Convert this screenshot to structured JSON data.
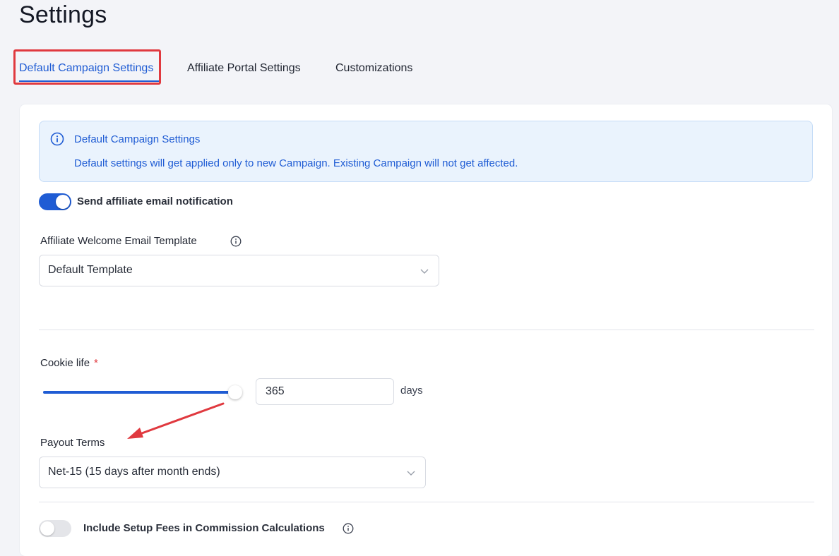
{
  "page": {
    "title": "Settings"
  },
  "tabs": [
    {
      "label": "Default Campaign Settings",
      "active": true
    },
    {
      "label": "Affiliate Portal Settings",
      "active": false
    },
    {
      "label": "Customizations",
      "active": false
    }
  ],
  "info": {
    "title": "Default Campaign Settings",
    "text": "Default settings will get applied only to new Campaign. Existing Campaign will not get affected.",
    "icon": "info-circle-icon"
  },
  "email_notification": {
    "label": "Send affiliate email notification",
    "enabled": true
  },
  "welcome_template": {
    "label": "Affiliate Welcome Email Template",
    "value": "Default Template"
  },
  "cookie_life": {
    "label": "Cookie life",
    "required_mark": "*",
    "value": "365",
    "unit": "days"
  },
  "payout_terms": {
    "label": "Payout Terms",
    "value": "Net-15 (15 days after month ends)"
  },
  "setup_fees": {
    "label": "Include Setup Fees in Commission Calculations",
    "enabled": false
  },
  "colors": {
    "accent": "#1f5cd4",
    "highlight": "#e0393f",
    "info_bg": "#eaf3fd"
  }
}
